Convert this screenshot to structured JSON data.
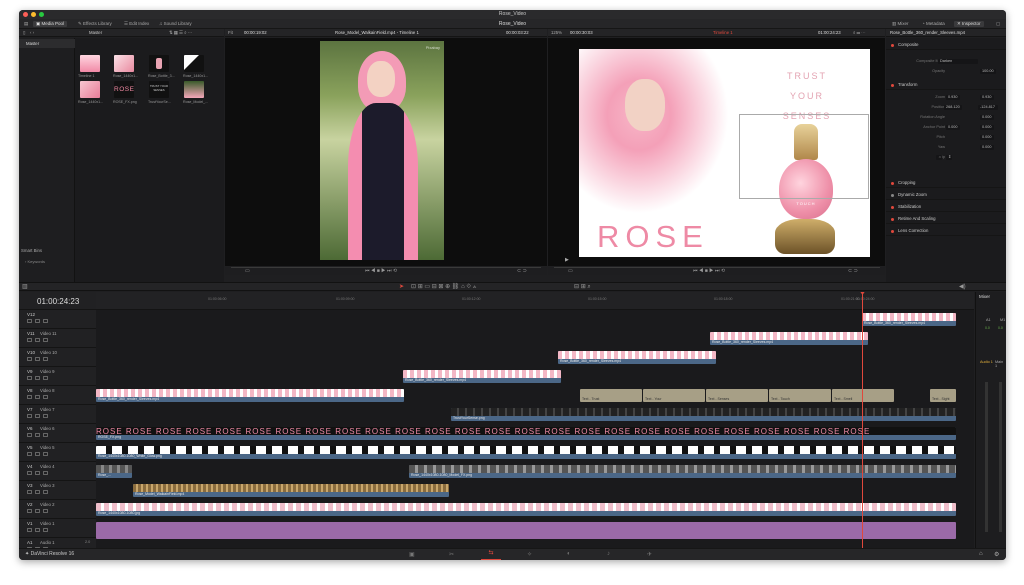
{
  "window": {
    "title": "Rose_Video",
    "project_title": "Rose_Video"
  },
  "toolbar": {
    "media_pool": "Media Pool",
    "effects_library": "Effects Library",
    "edit_index": "Edit Index",
    "sound_library": "Sound Library",
    "mixer": "Mixer",
    "metadata": "Metadata",
    "inspector": "Inspector"
  },
  "media_pool": {
    "bin_name": "Master",
    "folder": "Master",
    "smart_bins": "Smart Bins",
    "keywords": "Keywords",
    "clips": [
      {
        "label": "Timeline 1"
      },
      {
        "label": "Rose_1440x1..."
      },
      {
        "label": "Rose_Bottle_3..."
      },
      {
        "label": "Rose_1440x1..."
      },
      {
        "label": "Rose_1440x1..."
      },
      {
        "label": "ROSE_FX.png"
      },
      {
        "label": "TrustYourSe..."
      },
      {
        "label": "Rose_Model_..."
      }
    ],
    "thumb_rose_text": "ROSE",
    "thumb_trust_text": "TRUST YOUR SENSES"
  },
  "source_viewer": {
    "zoom": "Fit",
    "timecode_in": "00:00:19:02",
    "clip_name": "Rose_Model_WalkainField.mp4 - Timeline 1",
    "timecode_dur": "00:00:03:22",
    "watermark": "Pixabay"
  },
  "timeline_viewer": {
    "zoom": "125%",
    "duration": "00:00:30:03",
    "timeline_name": "Timeline 1",
    "timecode": "01:00:24:23",
    "rose_title": "ROSE",
    "trust_lines": [
      "TRUST",
      "YOUR",
      "SENSES"
    ],
    "bottle_text": "TOUCH"
  },
  "inspector": {
    "clip_name": "Rose_Bottle_360_render_Sleeves.mp4",
    "sections": {
      "composite": "Composite",
      "transform": "Transform",
      "cropping": "Cropping",
      "dynamic_zoom": "Dynamic Zoom",
      "stabilization": "Stabilization",
      "retime_scaling": "Retime And Scaling",
      "lens_correction": "Lens Correction"
    },
    "composite_mode_label": "Composite Mode",
    "composite_mode_value": "Darken",
    "opacity_label": "Opacity",
    "opacity_value": "100.00",
    "zoom_label": "Zoom",
    "zoom_x": "0.930",
    "zoom_y": "0.930",
    "position_label": "Position",
    "position_x": "268.120",
    "position_y": "-124.817",
    "rotation_label": "Rotation Angle",
    "rotation_value": "0.000",
    "anchor_label": "Anchor Point",
    "anchor_x": "0.000",
    "anchor_y": "0.000",
    "pitch_label": "Pitch",
    "pitch_value": "0.000",
    "yaw_label": "Yaw",
    "yaw_value": "0.000",
    "flip_label": "Flip"
  },
  "timeline": {
    "current_timecode": "01:00:24:23",
    "ruler": [
      "01:00:06:00",
      "01:00:09:00",
      "01:00:12:00",
      "01:00:15:00",
      "01:00:18:00",
      "01:00:21:00",
      "01:00:24:00"
    ],
    "tracks": [
      {
        "id": "V12",
        "name": ""
      },
      {
        "id": "V11",
        "name": "Video 11"
      },
      {
        "id": "V10",
        "name": "Video 10"
      },
      {
        "id": "V9",
        "name": "Video 9"
      },
      {
        "id": "V8",
        "name": "Video 8"
      },
      {
        "id": "V7",
        "name": "Video 7"
      },
      {
        "id": "V6",
        "name": "Video 6"
      },
      {
        "id": "V5",
        "name": "Video 5"
      },
      {
        "id": "V4",
        "name": "Video 4"
      },
      {
        "id": "V3",
        "name": "Video 3"
      },
      {
        "id": "V2",
        "name": "Video 2"
      },
      {
        "id": "V1",
        "name": "Video 1"
      },
      {
        "id": "A1",
        "name": "Audio 1"
      }
    ],
    "audio_level": "2.0",
    "clips": {
      "v12": "Rose_Bottle_360_render_Sleeves.mp4",
      "v11": "Rose_Bottle_360_render_Sleeves.mp4",
      "v10": "Rose_Bottle_360_render_Sleeves.mp4",
      "v9": "Rose_Bottle_360_render_Sleeves.mp4",
      "v8": "Rose_Bottle_360_render_Sleeves.mp4",
      "v8_text": [
        "Text - Trust",
        "Text - Your",
        "Text - Senses",
        "Text - Touch",
        "Text - Smell",
        "Text - Sight"
      ],
      "v7": "TrustYourSense.png",
      "v6": "ROSE_FX.png",
      "v6_pattern": "ROSE",
      "v5": "Rose_1440x1080-1080_White_Glow.png",
      "v4a": "Rose_...",
      "v4b": "Rose_1440x1080-1080_Model_FX.png",
      "v3": "Rose_Model_WalkainField.mp4",
      "v2": "Rose_1440x1080-1080.jpg"
    }
  },
  "mixer": {
    "title": "Mixer",
    "ch_a1": "A1",
    "ch_m1": "M1",
    "a1_val": "0.0",
    "m1_val": "0.0",
    "audio1": "Audio 1",
    "main1": "Main 1"
  },
  "app": {
    "name": "DaVinci Resolve 16"
  },
  "colors": {
    "accent_red": "#e0483c",
    "clip_blue": "#4b6787",
    "clip_purple": "#9b6aa8",
    "text_clip": "#a79f86"
  }
}
